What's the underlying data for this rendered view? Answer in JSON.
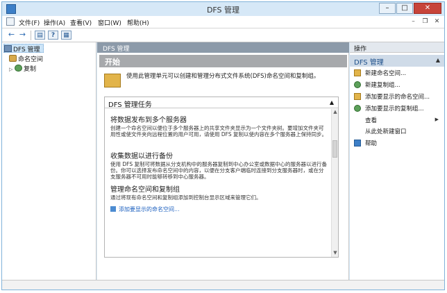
{
  "window": {
    "title": "DFS 管理"
  },
  "menubar": {
    "items": [
      "文件(F)",
      "操作(A)",
      "查看(V)",
      "窗口(W)",
      "帮助(H)"
    ]
  },
  "toolbar": {
    "back": "←",
    "forward": "→"
  },
  "tree": {
    "items": [
      {
        "label": "DFS 管理",
        "icon": "dfs-icon",
        "selected": true
      },
      {
        "label": "命名空间",
        "icon": "namespace-icon"
      },
      {
        "label": "复制",
        "icon": "replication-icon"
      }
    ]
  },
  "center": {
    "header": "DFS 管理",
    "start_title": "开始",
    "start_desc": "使用此管理单元可以创建和管理分布式文件系统(DFS)命名空间和复制组。",
    "tasks_title": "DFS 管理任务",
    "sections": [
      {
        "title": "将数据发布到多个服务器",
        "body": "创建一个命名空间以便位于多个服务器上的共享文件夹显示为一个文件夹树。要增加文件夹可用性或使文件夹向远程位置的用户可用，请使用 DFS 复制以使内容在多个服务器上保持同步。"
      },
      {
        "title": "收集数据以进行备份",
        "body": "使用 DFS 复制可将数据从分支机构中的服务器复制到中心办公室或数据中心的服务器以进行备份。你可以选择发布命名空间中的内容，以便在分支客户端临时连接到分支服务器时，或在分支服务器不可用时能够转移到中心服务器。"
      },
      {
        "title": "管理命名空间和复制组",
        "body": "通过将现有命名空间和复制组添加到控制台显示区域来管理它们。"
      }
    ],
    "link": "添加要显示的命名空间..."
  },
  "actions": {
    "header": "操作",
    "group": "DFS 管理",
    "items": [
      "新建命名空间...",
      "新建复制组...",
      "添加要显示的命名空间...",
      "添加要显示的复制组...",
      "查看",
      "从此处新建窗口",
      "帮助"
    ]
  }
}
